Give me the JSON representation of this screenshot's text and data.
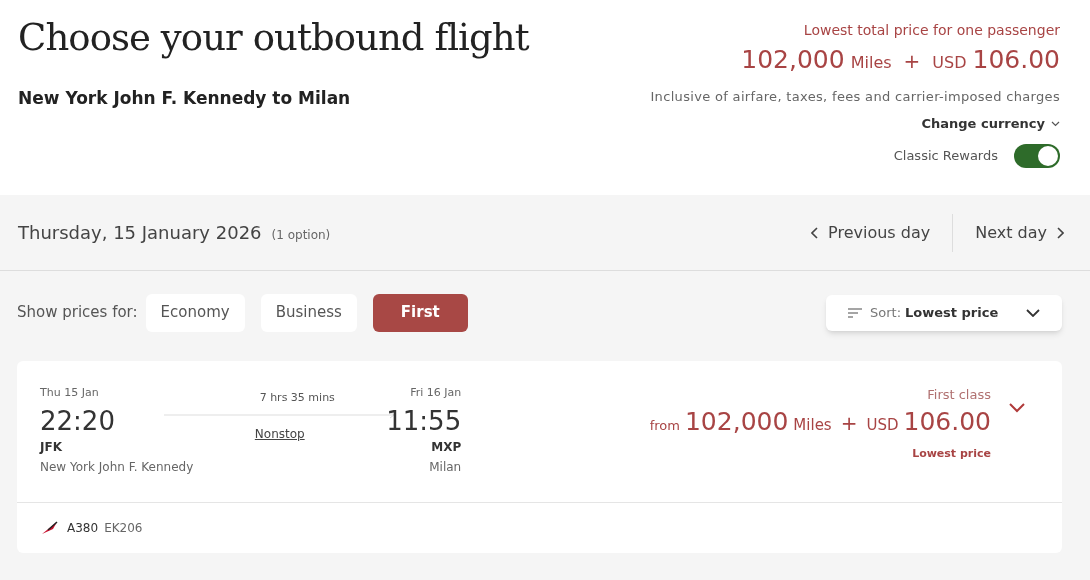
{
  "header": {
    "title": "Choose your outbound flight",
    "route": "New York John F. Kennedy to Milan"
  },
  "summary": {
    "label": "Lowest total price for one passenger",
    "miles": "102,000",
    "miles_unit": "Miles",
    "plus": "+",
    "currency": "USD",
    "amount": "106.00",
    "note": "Inclusive of airfare, taxes, fees and carrier-imposed charges",
    "change_currency": "Change currency",
    "classic_rewards": {
      "label": "Classic Rewards",
      "on": true
    }
  },
  "date_bar": {
    "date": "Thursday, 15 January 2026",
    "options": "(1 option)",
    "previous": "Previous day",
    "next": "Next day"
  },
  "filters": {
    "label": "Show prices for:",
    "cabins": [
      {
        "label": "Economy",
        "selected": false
      },
      {
        "label": "Business",
        "selected": false
      },
      {
        "label": "First",
        "selected": true
      }
    ],
    "sort": {
      "label": "Sort:",
      "value": "Lowest price"
    }
  },
  "flights": [
    {
      "depart_date": "Thu 15 Jan",
      "depart_time": "22:20",
      "depart_code": "JFK",
      "depart_city": "New York John F. Kennedy",
      "duration": "7 hrs 35 mins",
      "stops": "Nonstop",
      "arrive_date": "Fri 16 Jan",
      "arrive_time": "11:55",
      "arrive_code": "MXP",
      "arrive_city": "Milan",
      "cabin": "First class",
      "from": "from",
      "miles": "102,000",
      "miles_unit": "Miles",
      "plus": "+",
      "currency": "USD",
      "amount": "106.00",
      "price_note": "Lowest price",
      "aircraft": "A380",
      "flight_number": "EK206",
      "expanded": false
    }
  ]
}
